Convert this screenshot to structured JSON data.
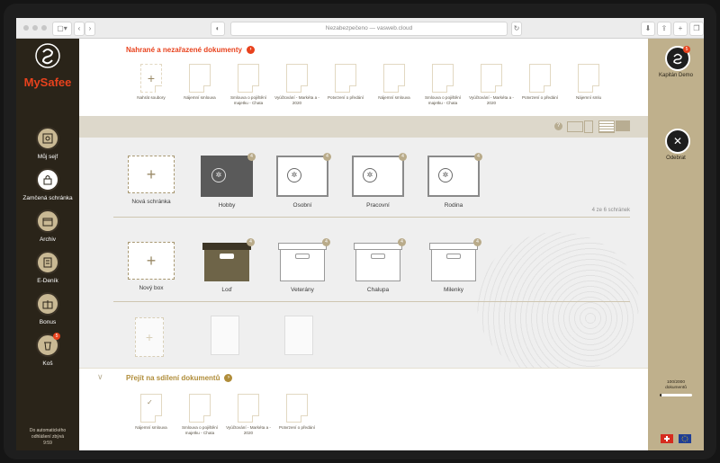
{
  "browser": {
    "url": "Nezabezpečeno — vasweb.cloud"
  },
  "brand": {
    "name": "MySafee",
    "accent": "#e8421d",
    "gold": "#bfb08c"
  },
  "sidebar": {
    "items": [
      {
        "label": "Můj sejf",
        "icon": "safe-icon"
      },
      {
        "label": "Zamčená schránka",
        "icon": "lock-icon"
      },
      {
        "label": "Archiv",
        "icon": "archive-icon"
      },
      {
        "label": "E-Deník",
        "icon": "notebook-icon"
      },
      {
        "label": "Bonus",
        "icon": "gift-icon"
      },
      {
        "label": "Koš",
        "icon": "trash-icon",
        "badge": "5"
      }
    ],
    "logout_line1": "Do automatického",
    "logout_line2": "odhlášení zbývá",
    "logout_time": "9:59"
  },
  "uploaded": {
    "title": "Nahrané a nezařazené dokumenty",
    "docs": [
      {
        "label": "Nahrát soubory",
        "type": "upload"
      },
      {
        "label": "Nájemní smlouva"
      },
      {
        "label": "Smlouva o pojištění majetku - Chata"
      },
      {
        "label": "Vyúčtování - Markéta a - 2020"
      },
      {
        "label": "Potvrzení o předání"
      },
      {
        "label": "Nájemní smlouva"
      },
      {
        "label": "Smlouva o pojištění majetku - Chata"
      },
      {
        "label": "Vyúčtování - Markéta a - 2020"
      },
      {
        "label": "Potvrzení o předání"
      },
      {
        "label": "Nájemní smlu"
      }
    ]
  },
  "safes": {
    "items": [
      {
        "label": "Nová schránka",
        "type": "new"
      },
      {
        "label": "Hobby",
        "type": "dark",
        "badge": "4"
      },
      {
        "label": "Osobní",
        "badge": "4"
      },
      {
        "label": "Pracovní",
        "badge": "4"
      },
      {
        "label": "Rodina",
        "badge": "4"
      }
    ],
    "count": "4 ze 6 schránek"
  },
  "boxes": {
    "items": [
      {
        "label": "Nový box",
        "type": "new"
      },
      {
        "label": "Loď",
        "type": "dark",
        "badge": "4"
      },
      {
        "label": "Veterány",
        "badge": "4"
      },
      {
        "label": "Chalupa",
        "badge": "4"
      },
      {
        "label": "Milenky",
        "badge": "4"
      }
    ]
  },
  "shared": {
    "title": "Přejít na sdílení dokumentů",
    "docs": [
      {
        "label": "Nájemní smlouva",
        "checked": true
      },
      {
        "label": "Smlouva o pojištění majetku - Chata"
      },
      {
        "label": "Vyúčtování - Markéta a - 2020"
      },
      {
        "label": "Potvrzení o předání"
      }
    ]
  },
  "user": {
    "name": "Kapitán Demo",
    "badge": "5"
  },
  "actions": {
    "remove_label": "Odebrat"
  },
  "storage": {
    "line1": "100/2000",
    "line2": "dokumentů",
    "fraction": 0.05
  }
}
